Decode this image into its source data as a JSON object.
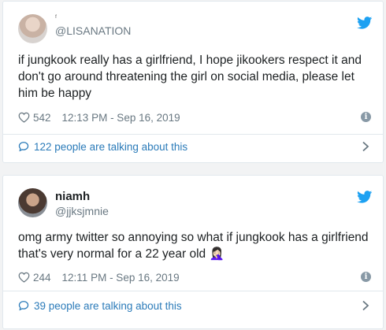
{
  "tweets": [
    {
      "display_name": "ᶠ",
      "handle": "@LISANATION",
      "text": "if jungkook really has a girlfriend, I hope jikookers respect it and don't go around threatening the girl on social media, please let him be happy",
      "likes": "542",
      "timestamp": "12:13 PM - Sep 16, 2019",
      "talking": "122 people are talking about this",
      "icons": {
        "avatar": "user-avatar",
        "brand": "twitter-bird-icon",
        "like": "heart-icon",
        "info": "info-icon",
        "reply": "comment-bubble-icon",
        "more": "chevron-right-icon"
      }
    },
    {
      "display_name": "niamh",
      "handle": "@jjksjmnie",
      "text": "omg army twitter so annoying so what if jungkook has a girlfriend that's very normal for a 22 year old 🤦🏻‍♀️",
      "likes": "244",
      "timestamp": "12:11 PM - Sep 16, 2019",
      "talking": "39 people are talking about this",
      "icons": {
        "avatar": "user-avatar",
        "brand": "twitter-bird-icon",
        "like": "heart-icon",
        "info": "info-icon",
        "reply": "comment-bubble-icon",
        "more": "chevron-right-icon"
      }
    }
  ],
  "colors": {
    "brand": "#1da1f2",
    "link": "#2b7bb9",
    "muted": "#697882",
    "border": "#e1e8ed"
  }
}
